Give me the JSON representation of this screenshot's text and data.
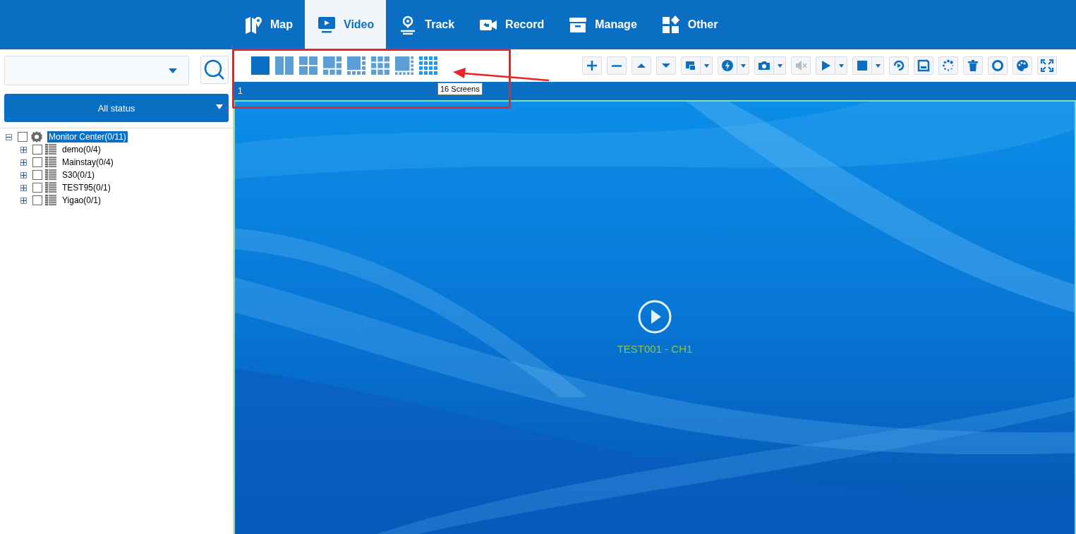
{
  "nav": [
    {
      "label": "Map",
      "kind": "map",
      "selected": false
    },
    {
      "label": "Video",
      "kind": "monitor",
      "selected": true
    },
    {
      "label": "Track",
      "kind": "pin",
      "selected": false
    },
    {
      "label": "Record",
      "kind": "camera",
      "selected": false
    },
    {
      "label": "Manage",
      "kind": "box",
      "selected": false
    },
    {
      "label": "Other",
      "kind": "tiles",
      "selected": false
    }
  ],
  "sidebar": {
    "status_filter": "All status",
    "tree": [
      {
        "label": "Monitor Center(0/11)",
        "kind": "root",
        "checked": false,
        "expanded": true,
        "selected": true,
        "children": [
          {
            "label": "demo(0/4)",
            "kind": "group",
            "checked": false,
            "expanded": false,
            "selected": false
          },
          {
            "label": "Mainstay(0/4)",
            "kind": "group",
            "checked": false,
            "expanded": false,
            "selected": false
          },
          {
            "label": "S30(0/1)",
            "kind": "group",
            "checked": false,
            "expanded": false,
            "selected": false
          },
          {
            "label": "TEST95(0/1)",
            "kind": "group",
            "checked": false,
            "expanded": false,
            "selected": false
          },
          {
            "label": "Yigao(0/1)",
            "kind": "group",
            "checked": false,
            "expanded": false,
            "selected": false
          }
        ]
      }
    ]
  },
  "video": {
    "layouts": [
      {
        "kind": "single",
        "selected": true,
        "hovered": false
      },
      {
        "kind": "two",
        "selected": false,
        "hovered": false
      },
      {
        "kind": "four",
        "selected": false,
        "hovered": false
      },
      {
        "kind": "six",
        "selected": false,
        "hovered": false
      },
      {
        "kind": "eight",
        "selected": false,
        "hovered": false
      },
      {
        "kind": "nine",
        "selected": false,
        "hovered": false
      },
      {
        "kind": "ten",
        "selected": false,
        "hovered": false
      },
      {
        "kind": "sixteen",
        "selected": false,
        "hovered": true
      }
    ],
    "tooltip": "16 Screens",
    "toolbar": [
      {
        "kind": "plus",
        "dropdown": false,
        "disabled": false
      },
      {
        "kind": "minus",
        "dropdown": false,
        "disabled": false
      },
      {
        "kind": "up",
        "dropdown": false,
        "disabled": false
      },
      {
        "kind": "down",
        "dropdown": false,
        "disabled": false
      },
      {
        "kind": "window",
        "dropdown": true,
        "disabled": false
      },
      {
        "kind": "flash",
        "dropdown": true,
        "disabled": false
      },
      {
        "kind": "camera",
        "dropdown": true,
        "disabled": false
      },
      {
        "kind": "mute",
        "dropdown": false,
        "disabled": true
      },
      {
        "kind": "play",
        "dropdown": true,
        "disabled": false
      },
      {
        "kind": "stop",
        "dropdown": true,
        "disabled": false
      },
      {
        "kind": "replay",
        "dropdown": false,
        "disabled": false
      },
      {
        "kind": "save",
        "dropdown": false,
        "disabled": false
      },
      {
        "kind": "loading",
        "dropdown": false,
        "disabled": false
      },
      {
        "kind": "trash",
        "dropdown": false,
        "disabled": false
      },
      {
        "kind": "ring",
        "dropdown": false,
        "disabled": false
      },
      {
        "kind": "palette",
        "dropdown": false,
        "disabled": false
      },
      {
        "kind": "fullscreen",
        "dropdown": false,
        "disabled": false
      }
    ],
    "tabs": [
      {
        "label": "1"
      }
    ],
    "channel": "TEST001 - CH1"
  }
}
